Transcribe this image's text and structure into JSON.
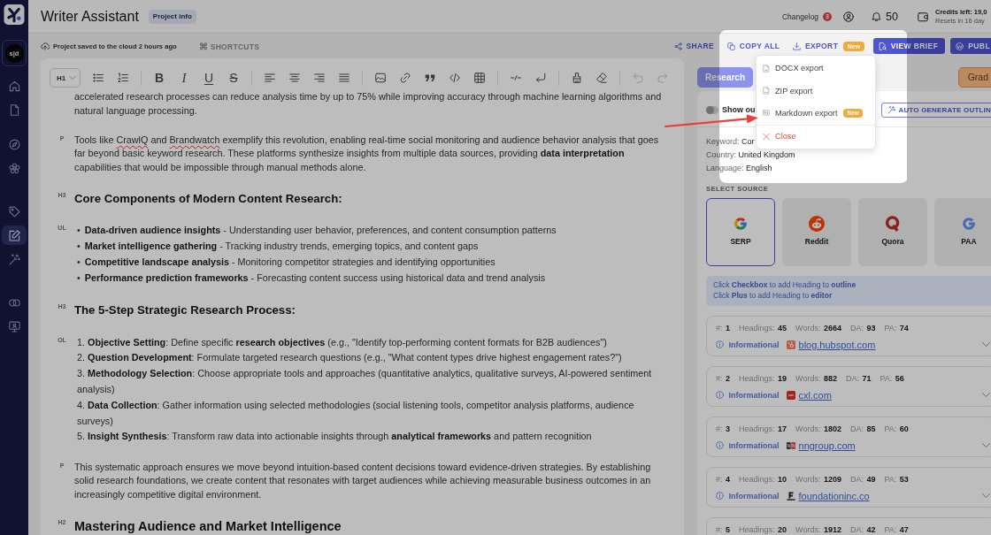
{
  "sidebar": {
    "workspace_avatar": "s|d",
    "groups": [
      {
        "items": [
          {
            "kind": "home",
            "selected": false
          },
          {
            "kind": "document",
            "selected": false
          }
        ]
      },
      {
        "items": [
          {
            "kind": "compass",
            "selected": false
          },
          {
            "kind": "flower",
            "selected": false
          }
        ]
      },
      {
        "items": [
          {
            "kind": "tag",
            "selected": false
          },
          {
            "kind": "edit",
            "selected": true
          },
          {
            "kind": "wand",
            "selected": false
          }
        ]
      },
      {
        "items": [
          {
            "kind": "rings",
            "selected": false
          },
          {
            "kind": "monitor",
            "selected": false
          }
        ]
      }
    ]
  },
  "header": {
    "title": "Writer Assistant",
    "project_badge": "Project info",
    "changelog": {
      "label": "Changelog",
      "count": "3"
    },
    "notifications": "50",
    "credits": {
      "label": "Credits left: 19,0",
      "reset": "Resets in 16 day"
    }
  },
  "action_bar": {
    "save_status": "Project saved to the cloud 2 hours ago",
    "shortcuts": {
      "icon": "⌘",
      "label": "SHORTCUTS"
    },
    "actions": [
      {
        "kind": "share",
        "label": "SHARE"
      },
      {
        "kind": "copy",
        "label": "COPY ALL"
      },
      {
        "kind": "export",
        "label": "EXPORT",
        "badge": "New"
      },
      {
        "kind": "brief",
        "label": "VIEW BRIEF"
      },
      {
        "kind": "publish",
        "label": "PUBL"
      }
    ]
  },
  "export_menu": {
    "open": true,
    "items": [
      {
        "kind": "docx",
        "label": "DOCX export"
      },
      {
        "kind": "zip",
        "label": "ZIP export"
      },
      {
        "kind": "markdown",
        "label": "Markdown export",
        "badge": "New"
      },
      {
        "kind": "close",
        "label": "Close"
      }
    ]
  },
  "editor": {
    "toolbar": {
      "block_type": "H1",
      "groups": [
        {
          "tools": [
            {
              "kind": "bullets",
              "disabled": false
            },
            {
              "kind": "numbers",
              "disabled": false
            }
          ]
        },
        {
          "tools": [
            {
              "kind": "bold",
              "glyph": "B",
              "disabled": false
            },
            {
              "kind": "italic",
              "glyph": "I",
              "disabled": false
            },
            {
              "kind": "underline",
              "glyph": "U",
              "disabled": false
            },
            {
              "kind": "strike",
              "glyph": "S",
              "disabled": false
            }
          ]
        },
        {
          "tools": [
            {
              "kind": "align-left",
              "disabled": false
            },
            {
              "kind": "align-center",
              "disabled": false
            },
            {
              "kind": "align-right",
              "disabled": false
            },
            {
              "kind": "justify",
              "disabled": false
            }
          ]
        },
        {
          "tools": [
            {
              "kind": "image",
              "disabled": false
            },
            {
              "kind": "link",
              "disabled": false
            },
            {
              "kind": "quote",
              "disabled": false
            },
            {
              "kind": "code",
              "disabled": false
            },
            {
              "kind": "table",
              "disabled": false
            }
          ]
        },
        {
          "tools": [
            {
              "kind": "rule",
              "disabled": false
            },
            {
              "kind": "break",
              "disabled": false
            }
          ]
        },
        {
          "tools": [
            {
              "kind": "brush",
              "disabled": false
            },
            {
              "kind": "eraser",
              "disabled": false
            }
          ]
        },
        {
          "tools": [
            {
              "kind": "undo",
              "disabled": true
            },
            {
              "kind": "redo",
              "disabled": true
            }
          ]
        }
      ]
    },
    "blocks": [
      {
        "kind": "p",
        "spans": [
          {
            "text": "accelerated research processes can reduce analysis time by up to 75% while improving accuracy through machine learning algorithms and natural language processing.",
            "misspelled": false
          }
        ]
      },
      {
        "kind": "p",
        "label": "P",
        "spans": [
          {
            "text": "Tools like ",
            "misspelled": false
          },
          {
            "text": "CrawlQ",
            "misspelled": true
          },
          {
            "text": " and ",
            "misspelled": false
          },
          {
            "text": "Brandwatch",
            "misspelled": true
          },
          {
            "text": " exemplify this revolution, enabling real-time social monitoring and audience behavior analysis that goes far beyond basic keyword research. These platforms synthesize insights from multiple data sources, providing **data interpretation** capabilities that would be impossible through manual methods alone.",
            "misspelled": false
          }
        ]
      },
      {
        "kind": "h3",
        "label": "H3",
        "text": "Core Components of Modern Content Research:"
      },
      {
        "kind": "ul",
        "label": "UL",
        "items": [
          {
            "marker": "•",
            "text": "**Data-driven audience insights** - Understanding user behavior, preferences, and content consumption patterns"
          },
          {
            "marker": "•",
            "text": "**Market intelligence gathering** - Tracking industry trends, emerging topics, and content gaps"
          },
          {
            "marker": "•",
            "text": "**Competitive landscape analysis** - Monitoring competitor strategies and identifying opportunities"
          },
          {
            "marker": "•",
            "text": "**Performance prediction frameworks** - Forecasting content success using historical data and trend analysis"
          }
        ]
      },
      {
        "kind": "h3",
        "label": "H3",
        "text": "The 5-Step Strategic Research Process:"
      },
      {
        "kind": "ol",
        "label": "OL",
        "items": [
          {
            "marker": "1.",
            "text": "**Objective Setting**: Define specific **research objectives** (e.g., \"Identify top-performing content formats for B2B audiences\")"
          },
          {
            "marker": "2.",
            "text": "**Question Development**: Formulate targeted research questions (e.g., \"What content types drive highest engagement rates?\")"
          },
          {
            "marker": "3.",
            "text": "**Methodology Selection**: Choose appropriate tools and approaches (quantitative analytics, qualitative surveys, AI-powered sentiment analysis)"
          },
          {
            "marker": "4.",
            "text": "**Data Collection**: Gather information using selected methodologies (social listening tools, competitor analysis platforms, audience surveys)"
          },
          {
            "marker": "5.",
            "text": "**Insight Synthesis**: Transform raw data into actionable insights through **analytical frameworks** and pattern recognition"
          }
        ]
      },
      {
        "kind": "p",
        "label": "P",
        "spans": [
          {
            "text": "This systematic approach ensures we move beyond intuition-based content decisions toward evidence-driven strategies. By establishing solid research foundations, we create content that resonates with target audiences while achieving measurable business outcomes in an increasingly competitive digital environment.",
            "misspelled": false
          }
        ]
      },
      {
        "kind": "h2",
        "label": "H2",
        "text": "Mastering Audience and Market Intelligence"
      }
    ]
  },
  "research": {
    "tabs": [
      {
        "kind": "tab",
        "label": "Research",
        "selected": true
      },
      {
        "kind": "grade",
        "label": "Grad",
        "selected": false
      }
    ],
    "outline_toggle": {
      "label": "Show ou",
      "on": false
    },
    "auto_generate": "AUTO GENERATE OUTLIN",
    "meta": [
      {
        "key": "Keyword:",
        "value": "Cor"
      },
      {
        "key": "Country:",
        "value": "United Kingdom"
      },
      {
        "key": "Language:",
        "value": "English"
      }
    ],
    "source_heading": "SELECT SOURCE",
    "sources": [
      {
        "kind": "google",
        "label": "SERP",
        "selected": true
      },
      {
        "kind": "reddit",
        "label": "Reddit",
        "selected": false
      },
      {
        "kind": "quora",
        "label": "Quora",
        "selected": false
      },
      {
        "kind": "paa",
        "label": "PAA",
        "selected": false
      }
    ],
    "hint": [
      "Click **Checkbox** to add Heading to **outline**",
      "Click **Plus** to add Heading to **editor**"
    ],
    "results": [
      {
        "stats": [
          {
            "label": "#:",
            "value": "1"
          },
          {
            "label": "Headings:",
            "value": "45"
          },
          {
            "label": "Words:",
            "value": "2664"
          },
          {
            "label": "DA:",
            "value": "93"
          },
          {
            "label": "PA:",
            "value": "74"
          }
        ],
        "intent": "Informational",
        "favicon": {
          "kind": "hubspot"
        },
        "domain": "blog.hubspot.com",
        "expanded": false
      },
      {
        "stats": [
          {
            "label": "#:",
            "value": "2"
          },
          {
            "label": "Headings:",
            "value": "19"
          },
          {
            "label": "Words:",
            "value": "882"
          },
          {
            "label": "DA:",
            "value": "71"
          },
          {
            "label": "PA:",
            "value": "56"
          }
        ],
        "intent": "Informational",
        "favicon": {
          "kind": "cxl"
        },
        "domain": "cxl.com",
        "expanded": false
      },
      {
        "stats": [
          {
            "label": "#:",
            "value": "3"
          },
          {
            "label": "Headings:",
            "value": "17"
          },
          {
            "label": "Words:",
            "value": "1802"
          },
          {
            "label": "DA:",
            "value": "85"
          },
          {
            "label": "PA:",
            "value": "60"
          }
        ],
        "intent": "Informational",
        "favicon": {
          "kind": "nngroup"
        },
        "domain": "nngroup.com",
        "expanded": false
      },
      {
        "stats": [
          {
            "label": "#:",
            "value": "4"
          },
          {
            "label": "Headings:",
            "value": "10"
          },
          {
            "label": "Words:",
            "value": "1209"
          },
          {
            "label": "DA:",
            "value": "49"
          },
          {
            "label": "PA:",
            "value": "53"
          }
        ],
        "intent": "Informational",
        "favicon": {
          "kind": "foundation"
        },
        "domain": "foundationinc.co",
        "expanded": false
      },
      {
        "stats": [
          {
            "label": "#:",
            "value": "5"
          },
          {
            "label": "Headings:",
            "value": "20"
          },
          {
            "label": "Words:",
            "value": "1912"
          },
          {
            "label": "DA:",
            "value": "42"
          },
          {
            "label": "PA:",
            "value": "47"
          }
        ]
      }
    ]
  }
}
